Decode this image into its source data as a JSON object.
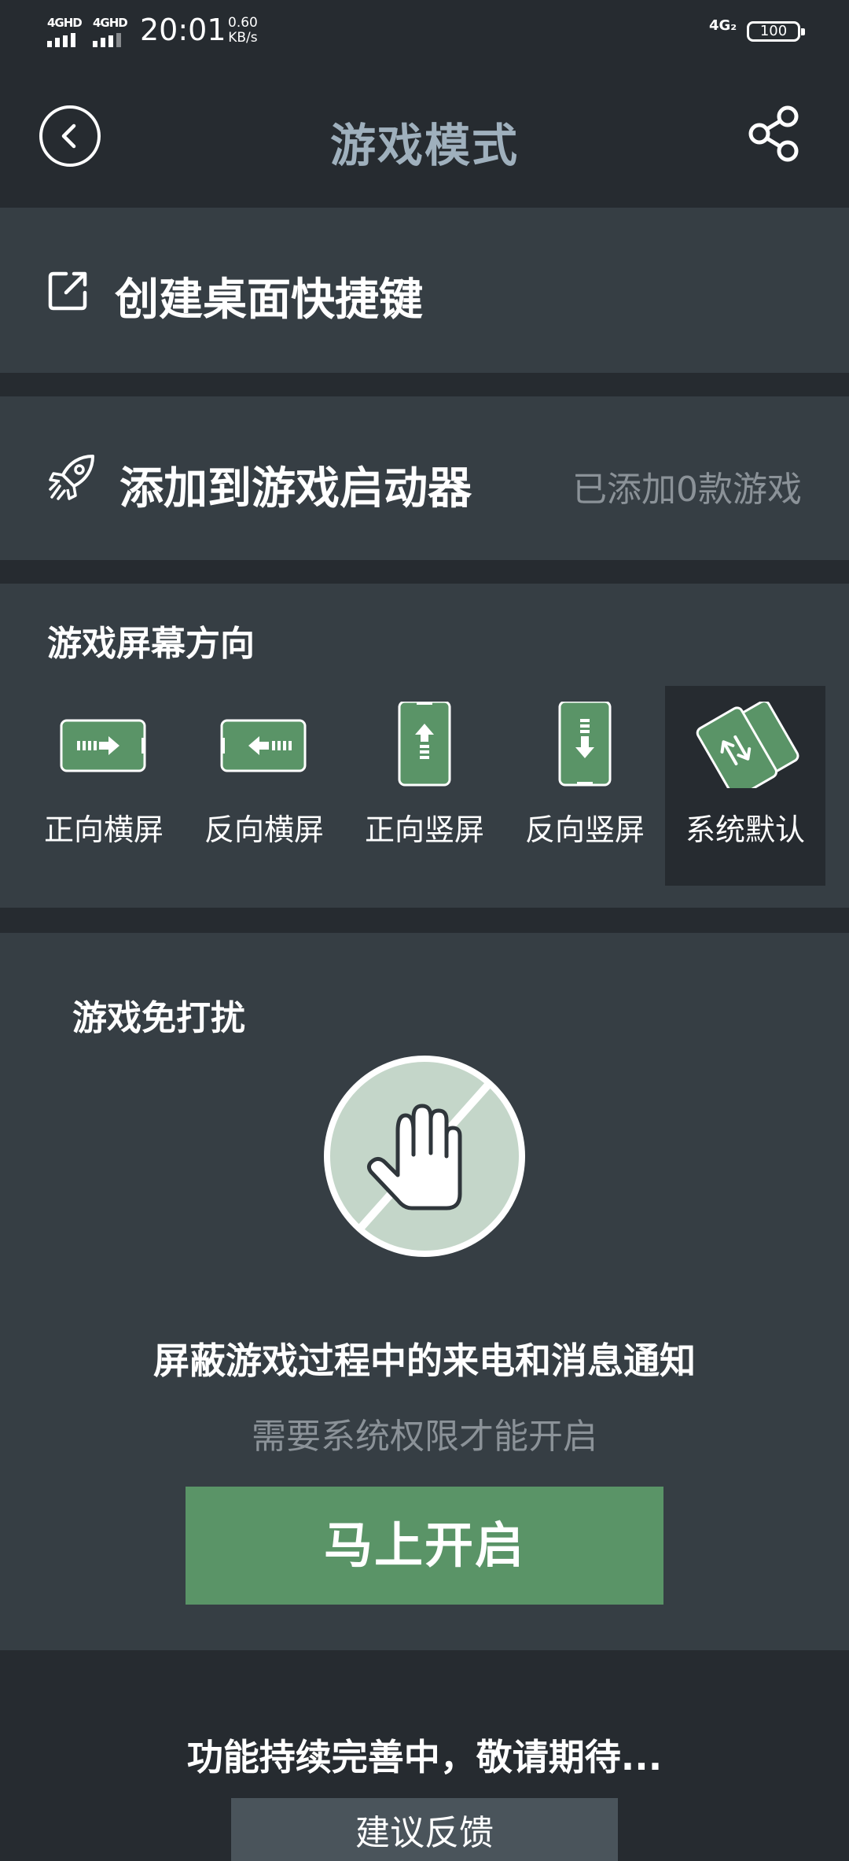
{
  "status_bar": {
    "signal1": "4GHD",
    "signal2": "4GHD",
    "time": "20:01",
    "speed_value": "0.60",
    "speed_unit": "KB/s",
    "network_right": "4G₂",
    "battery": "100"
  },
  "header": {
    "title": "游戏模式",
    "back_icon": "back-icon",
    "share_icon": "share-icon"
  },
  "shortcut": {
    "label": "创建桌面快捷键",
    "icon": "external-link-icon"
  },
  "launcher": {
    "label": "添加到游戏启动器",
    "hint": "已添加0款游戏",
    "icon": "rocket-icon"
  },
  "orientation": {
    "title": "游戏屏幕方向",
    "options": [
      {
        "label": "正向横屏"
      },
      {
        "label": "反向横屏"
      },
      {
        "label": "正向竖屏"
      },
      {
        "label": "反向竖屏"
      },
      {
        "label": "系统默认"
      }
    ],
    "selected": "系统默认"
  },
  "dnd": {
    "title": "游戏免打扰",
    "description": "屏蔽游戏过程中的来电和消息通知",
    "note": "需要系统权限才能开启",
    "button_label": "马上开启"
  },
  "footer": {
    "note": "功能持续完善中，敬请期待...",
    "feedback_label": "建议反馈"
  },
  "colors": {
    "accent": "#5a9467",
    "card": "#363e44",
    "background": "#262b30",
    "title": "#9fb0bd",
    "muted": "#8b9298"
  }
}
